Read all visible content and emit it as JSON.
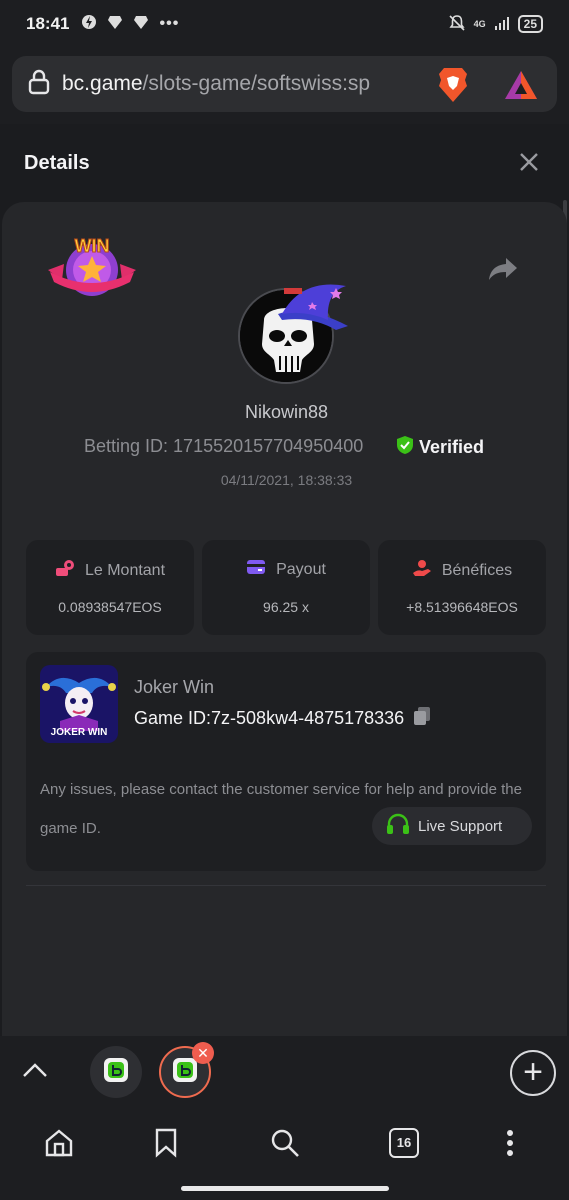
{
  "status_bar": {
    "time": "18:41",
    "network": "4G",
    "battery": "25"
  },
  "browser": {
    "url_domain": "bc.game",
    "url_path": "/slots-game/softswiss:sp",
    "tab_count": "16"
  },
  "details": {
    "title": "Details",
    "username": "Nikowin88",
    "betting_id": "Betting ID: 1715520157704950400",
    "verified": "Verified",
    "datetime": "04/11/2021, 18:38:33",
    "stats": [
      {
        "label": "Le Montant",
        "value": "0.08938547EOS",
        "color": "#ef4d7a"
      },
      {
        "label": "Payout",
        "value": "96.25 x",
        "color": "#7f5af0"
      },
      {
        "label": "Bénéfices",
        "value": "+8.51396648EOS",
        "color": "#ef4a4a"
      }
    ],
    "game": {
      "name": "Joker Win",
      "id_label": "Game ID:",
      "id_value": "7z-508kw4-4875178336",
      "thumb_text": "JOKER WIN",
      "issues_text": "Any issues, please contact the customer service for help and provide the game ID.",
      "live_support": "Live Support"
    },
    "badge_text": "WIN"
  },
  "colors": {
    "accent_green": "#3bc117",
    "brave_orange": "#f1562b",
    "tab_border": "#ef6b4f"
  }
}
